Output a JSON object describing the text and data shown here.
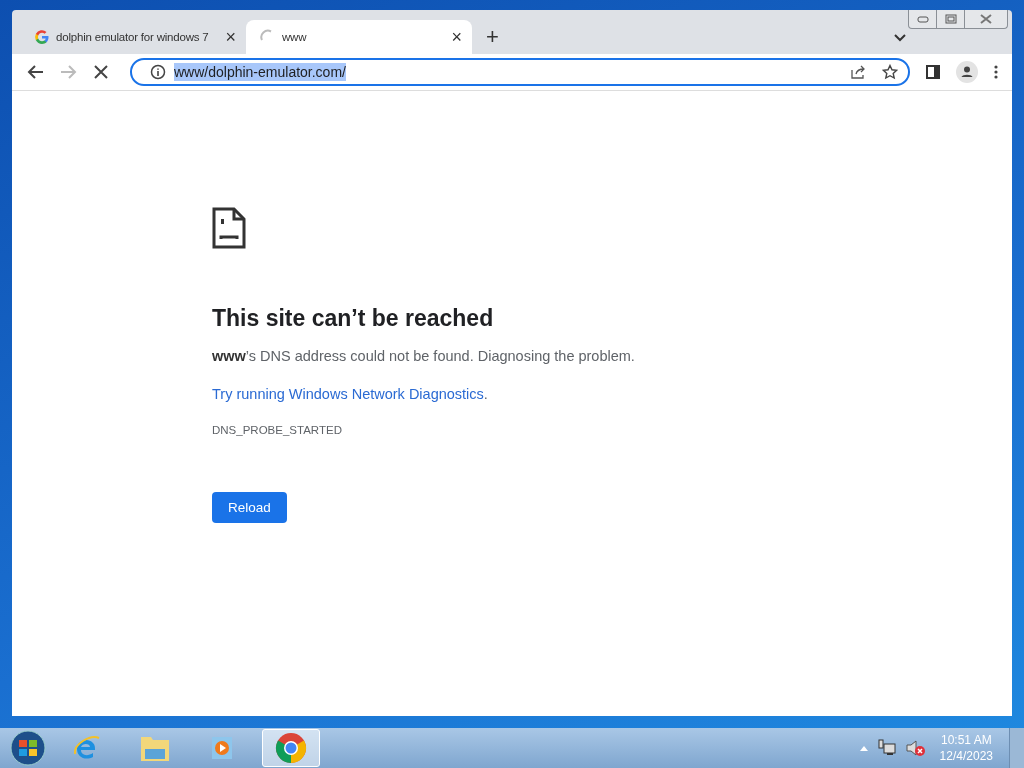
{
  "tabs": [
    {
      "title": "dolphin emulator for windows 7",
      "selected": false,
      "close": "×"
    },
    {
      "title": "www",
      "selected": true,
      "close": "×"
    }
  ],
  "new_tab": "+",
  "address": {
    "url": "www/dolphin-emulator.com/",
    "selected": true
  },
  "error_page": {
    "heading": "This site can’t be reached",
    "message": "**www**’s DNS address could not be found. Diagnosing the problem.",
    "suggestion_link": "Try running Windows Network Diagnostics",
    "suggestion_suffix": ".",
    "error_code": "DNS_PROBE_STARTED",
    "reload_button": "Reload"
  },
  "taskbar": {
    "apps": [
      {
        "kind": "ie",
        "selected": false
      },
      {
        "kind": "explorer",
        "selected": false
      },
      {
        "kind": "media",
        "selected": false
      },
      {
        "kind": "chrome",
        "selected": true
      }
    ],
    "time": "10:51 AM",
    "date": "12/4/2023"
  }
}
